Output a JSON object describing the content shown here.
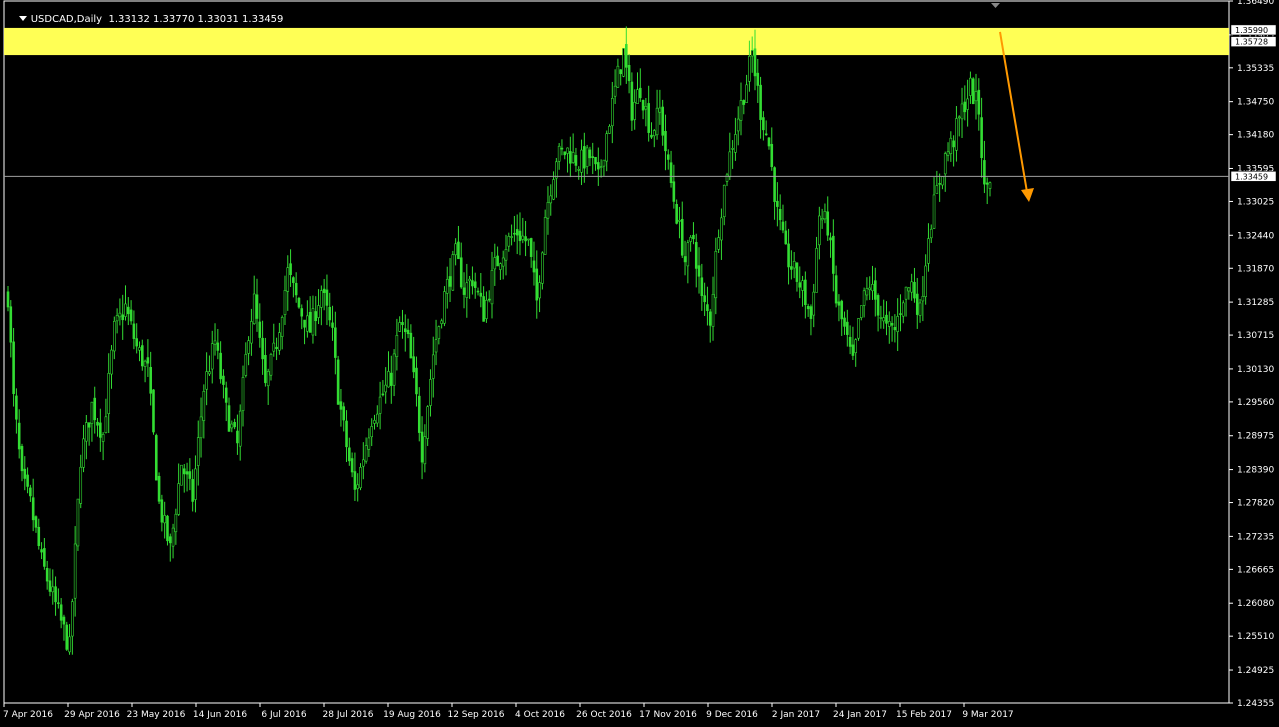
{
  "header": {
    "symbol_timeframe": "USDCAD,Daily",
    "ohlc": "1.33132 1.33770 1.33031 1.33459"
  },
  "colors": {
    "background": "#000000",
    "frame": "#ffffff",
    "candle": "#33dd33",
    "resistance_zone": "#ffff55",
    "current_price_line": "#a0a0a0",
    "forecast_arrow": "#ff9900"
  },
  "chart_data": {
    "type": "candlestick",
    "title": "",
    "symbol": "USDCAD",
    "timeframe": "Daily",
    "ylim": [
      1.24355,
      1.3649
    ],
    "y_ticks": [
      "1.36490",
      "1.35905",
      "1.35335",
      "1.34750",
      "1.34180",
      "1.33595",
      "1.33025",
      "1.32440",
      "1.31870",
      "1.31285",
      "1.30715",
      "1.30130",
      "1.29560",
      "1.28975",
      "1.28390",
      "1.27820",
      "1.27235",
      "1.26665",
      "1.26080",
      "1.25510",
      "1.24925",
      "1.24355"
    ],
    "x_ticks": [
      "7 Apr 2016",
      "29 Apr 2016",
      "23 May 2016",
      "14 Jun 2016",
      "6 Jul 2016",
      "28 Jul 2016",
      "19 Aug 2016",
      "12 Sep 2016",
      "4 Oct 2016",
      "26 Oct 2016",
      "17 Nov 2016",
      "9 Dec 2016",
      "2 Jan 2017",
      "24 Jan 2017",
      "15 Feb 2017",
      "9 Mar 2017"
    ],
    "current_price": 1.33459,
    "current_price_label": "1.33459",
    "resistance_zone": {
      "high": 1.3599,
      "low": 1.35728,
      "high_label": "1.35990",
      "low_label": "1.35728"
    },
    "forecast": {
      "from": 1.3599,
      "to": 1.3305
    },
    "close_path": [
      [
        0,
        1.314
      ],
      [
        2,
        1.296
      ],
      [
        5,
        1.282
      ],
      [
        8,
        1.278
      ],
      [
        12,
        1.268
      ],
      [
        16,
        1.262
      ],
      [
        20,
        1.256
      ],
      [
        22,
        1.253
      ],
      [
        26,
        1.286
      ],
      [
        30,
        1.295
      ],
      [
        34,
        1.29
      ],
      [
        38,
        1.308
      ],
      [
        42,
        1.312
      ],
      [
        46,
        1.305
      ],
      [
        50,
        1.301
      ],
      [
        54,
        1.278
      ],
      [
        58,
        1.27
      ],
      [
        62,
        1.285
      ],
      [
        66,
        1.279
      ],
      [
        70,
        1.298
      ],
      [
        74,
        1.306
      ],
      [
        78,
        1.294
      ],
      [
        82,
        1.288
      ],
      [
        86,
        1.308
      ],
      [
        88,
        1.313
      ],
      [
        92,
        1.298
      ],
      [
        96,
        1.306
      ],
      [
        100,
        1.318
      ],
      [
        104,
        1.312
      ],
      [
        108,
        1.308
      ],
      [
        112,
        1.315
      ],
      [
        116,
        1.307
      ],
      [
        118,
        1.297
      ],
      [
        121,
        1.288
      ],
      [
        124,
        1.28
      ],
      [
        126,
        1.284
      ],
      [
        130,
        1.293
      ],
      [
        134,
        1.297
      ],
      [
        137,
        1.3
      ],
      [
        140,
        1.309
      ],
      [
        143,
        1.306
      ],
      [
        146,
        1.296
      ],
      [
        148,
        1.287
      ],
      [
        152,
        1.304
      ],
      [
        156,
        1.314
      ],
      [
        160,
        1.321
      ],
      [
        163,
        1.315
      ],
      [
        166,
        1.317
      ],
      [
        170,
        1.311
      ],
      [
        174,
        1.319
      ],
      [
        178,
        1.323
      ],
      [
        182,
        1.325
      ],
      [
        186,
        1.323
      ],
      [
        189,
        1.313
      ],
      [
        192,
        1.328
      ],
      [
        196,
        1.338
      ],
      [
        200,
        1.339
      ],
      [
        204,
        1.337
      ],
      [
        208,
        1.338
      ],
      [
        211,
        1.334
      ],
      [
        214,
        1.342
      ],
      [
        218,
        1.352
      ],
      [
        220,
        1.356
      ],
      [
        223,
        1.346
      ],
      [
        226,
        1.35
      ],
      [
        230,
        1.342
      ],
      [
        233,
        1.346
      ],
      [
        236,
        1.336
      ],
      [
        239,
        1.328
      ],
      [
        242,
        1.32
      ],
      [
        245,
        1.324
      ],
      [
        248,
        1.313
      ],
      [
        251,
        1.31
      ],
      [
        254,
        1.326
      ],
      [
        257,
        1.336
      ],
      [
        261,
        1.345
      ],
      [
        264,
        1.351
      ],
      [
        266,
        1.356
      ],
      [
        269,
        1.346
      ],
      [
        272,
        1.34
      ],
      [
        275,
        1.328
      ],
      [
        278,
        1.321
      ],
      [
        281,
        1.318
      ],
      [
        284,
        1.315
      ],
      [
        287,
        1.31
      ],
      [
        290,
        1.328
      ],
      [
        293,
        1.326
      ],
      [
        296,
        1.313
      ],
      [
        299,
        1.308
      ],
      [
        302,
        1.302
      ],
      [
        305,
        1.312
      ],
      [
        308,
        1.316
      ],
      [
        311,
        1.312
      ],
      [
        314,
        1.308
      ],
      [
        317,
        1.308
      ],
      [
        320,
        1.314
      ],
      [
        323,
        1.316
      ],
      [
        326,
        1.311
      ],
      [
        329,
        1.325
      ],
      [
        332,
        1.332
      ],
      [
        335,
        1.338
      ],
      [
        338,
        1.341
      ],
      [
        341,
        1.346
      ],
      [
        344,
        1.35
      ],
      [
        347,
        1.346
      ],
      [
        349,
        1.332
      ],
      [
        351,
        1.3346
      ]
    ]
  }
}
